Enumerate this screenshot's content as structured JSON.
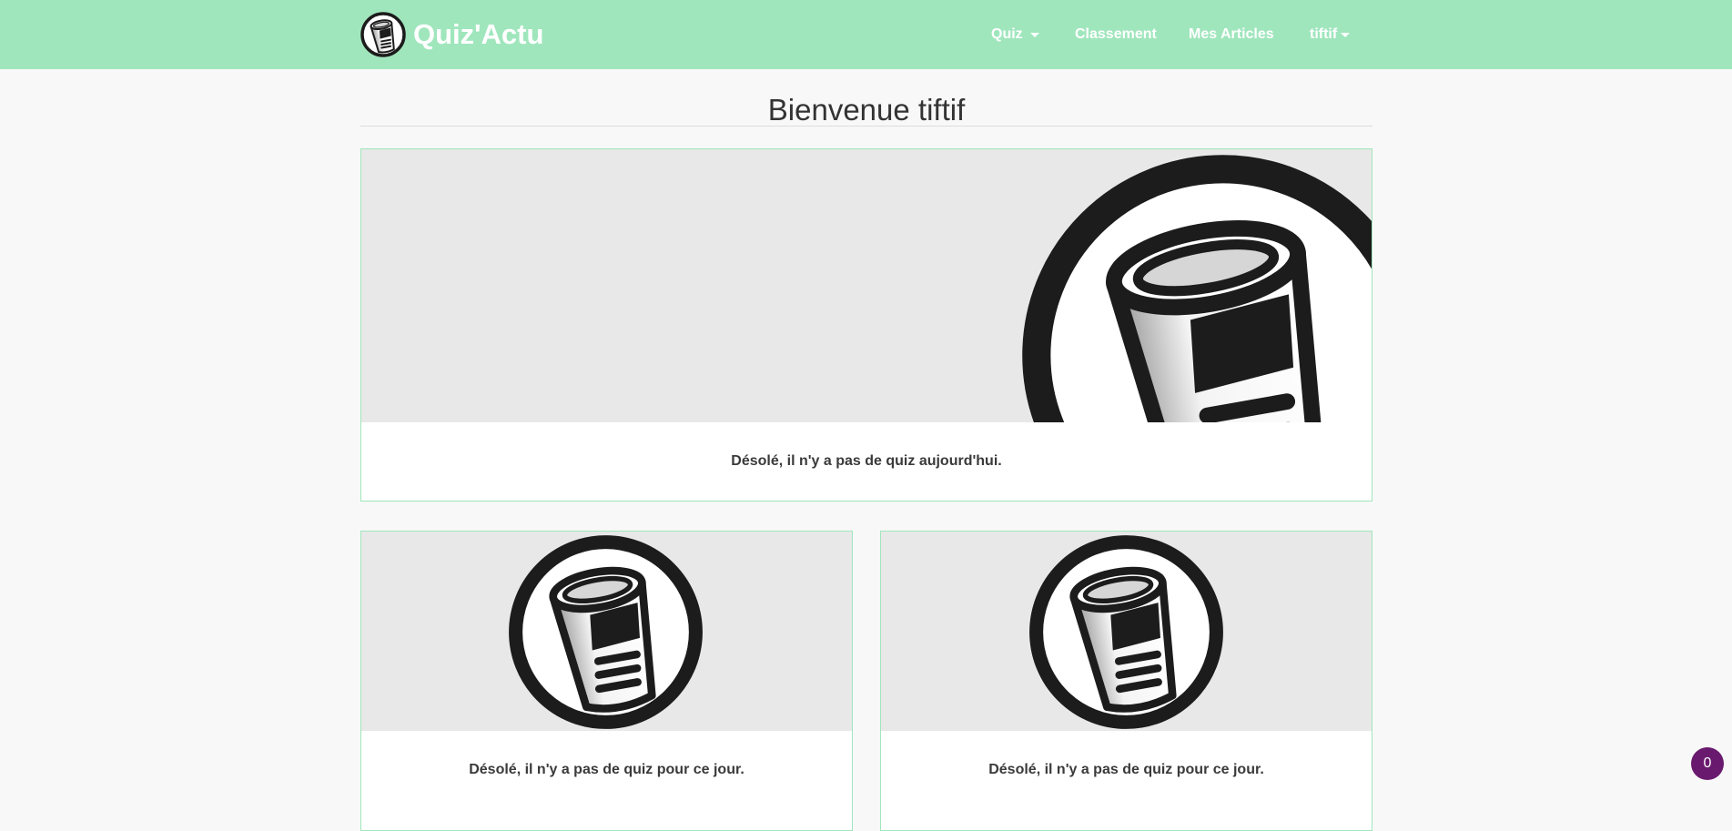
{
  "navbar": {
    "brand": "Quiz'Actu",
    "items": [
      {
        "label": "Quiz",
        "dropdown": true
      },
      {
        "label": "Classement",
        "dropdown": false
      },
      {
        "label": "Mes Articles",
        "dropdown": false
      },
      {
        "label": "tiftif",
        "dropdown": true
      }
    ]
  },
  "main": {
    "title": "Bienvenue tiftif",
    "featured": {
      "image_icon": "newspaper-logo-icon",
      "text": "Désolé, il n'y a pas de quiz aujourd'hui."
    },
    "cards": [
      {
        "image_icon": "newspaper-logo-icon",
        "text": "Désolé, il n'y a pas de quiz pour ce jour."
      },
      {
        "image_icon": "newspaper-logo-icon",
        "text": "Désolé, il n'y a pas de quiz pour ce jour."
      }
    ]
  },
  "notification": {
    "count": "0"
  },
  "colors": {
    "navbar_bg": "#a0e6bd",
    "card_border": "#a0e6bd",
    "image_bg": "#e8e8e8",
    "badge_bg": "#6a1a6e"
  }
}
